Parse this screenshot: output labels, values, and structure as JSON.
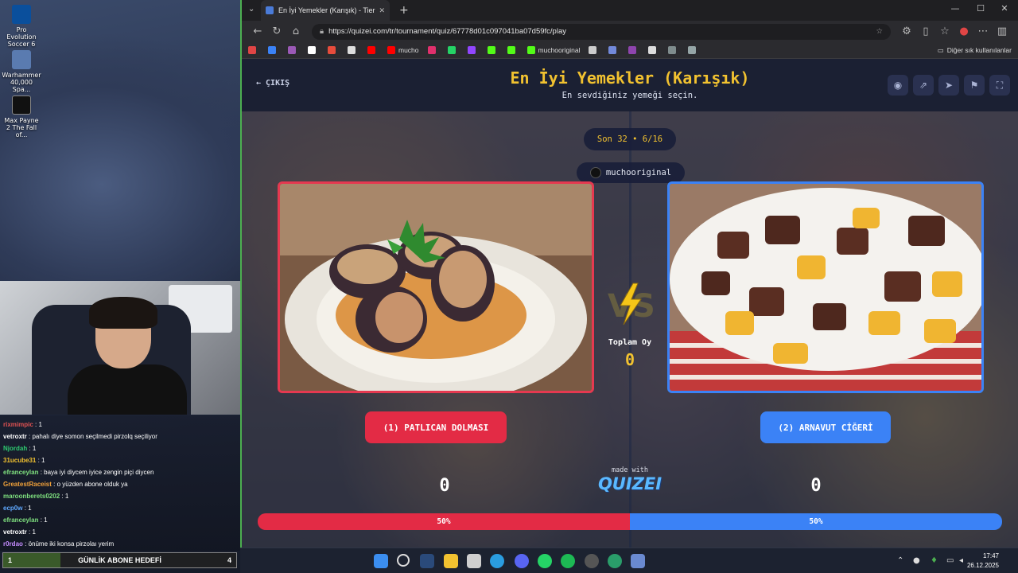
{
  "desktop": {
    "icons": [
      {
        "label": "Pro Evolution Soccer 6",
        "color": "#0a4f9c"
      },
      {
        "label": "Warhammer 40,000 Spa...",
        "color": "#5a7bb0"
      },
      {
        "label": "Max Payne 2 The Fall of...",
        "color": "#111111"
      }
    ]
  },
  "chat": {
    "lines": [
      {
        "user": "rixmimpic",
        "text": ": 1",
        "color": "#e05252"
      },
      {
        "user": "vetroxtr",
        "text": ": pahalı diye somon seçilmedi pirzolq seçiliyor",
        "color": "#ffffff"
      },
      {
        "user": "Njordah",
        "text": ": 1",
        "color": "#2ecc71"
      },
      {
        "user": "31ucube31",
        "text": ": 1",
        "color": "#f2c230"
      },
      {
        "user": "efranceylan",
        "text": ": baya iyi diycem iyice zengin piçi diycen",
        "color": "#7fe07f"
      },
      {
        "user": "GreatestRaceist",
        "text": ": o yüzden abone olduk ya",
        "color": "#f2a23a"
      },
      {
        "user": "maroonberets0202",
        "text": ": 1",
        "color": "#7fe07f"
      },
      {
        "user": "ecp0w",
        "text": ": 1",
        "color": "#5fa8ff"
      },
      {
        "user": "efranceylan",
        "text": ": 1",
        "color": "#7fe07f"
      },
      {
        "user": "vetroxtr",
        "text": ": 1",
        "color": "#ffffff"
      },
      {
        "user": "r0rdao",
        "text": ": önüme iki konsa pirzolaı yerim",
        "color": "#c58cff"
      }
    ],
    "goal": {
      "current": "1",
      "label": "GÜNLİK ABONE HEDEFİ",
      "target": "4"
    }
  },
  "browser": {
    "tab_title": "En İyi Yemekler (Karışık) - Tier List...",
    "url": "https://quizei.com/tr/tournament/quiz/67778d01c097041ba07d59fc/play",
    "bookmarks": [
      {
        "label": "",
        "color": "#e04545"
      },
      {
        "label": "",
        "color": "#3b82f6"
      },
      {
        "label": "",
        "color": "#9b59b6"
      },
      {
        "label": "",
        "color": "#ffffff"
      },
      {
        "label": "",
        "color": "#e74c3c"
      },
      {
        "label": "",
        "color": "#dddddd"
      },
      {
        "label": "",
        "color": "#ff0000"
      },
      {
        "label": "mucho",
        "color": "#ff0000"
      },
      {
        "label": "",
        "color": "#e1306c"
      },
      {
        "label": "",
        "color": "#25d366"
      },
      {
        "label": "",
        "color": "#9146ff"
      },
      {
        "label": "",
        "color": "#53fc18"
      },
      {
        "label": "",
        "color": "#53fc18"
      },
      {
        "label": "muchooriginal",
        "color": "#53fc18"
      },
      {
        "label": "",
        "color": "#cccccc"
      },
      {
        "label": "",
        "color": "#7289da"
      },
      {
        "label": "",
        "color": "#8e44ad"
      },
      {
        "label": "",
        "color": "#dddddd"
      },
      {
        "label": "",
        "color": "#7f8c8d"
      },
      {
        "label": "",
        "color": "#95a5a6"
      }
    ],
    "other_bookmarks": "Diğer sık kullanılanlar"
  },
  "quiz": {
    "exit_label": "ÇIKIŞ",
    "title": "En İyi Yemekler (Karışık)",
    "subtitle": "En sevdiğiniz yemeği seçin.",
    "round": "Son 32 • 6/16",
    "creator": "muchooriginal",
    "left": {
      "label": "(1) PATLICAN DOLMASI",
      "votes": "0",
      "percent": "50%",
      "color": "#e32b45"
    },
    "right": {
      "label": "(2) ARNAVUT CİĞERİ",
      "votes": "0",
      "percent": "50%",
      "color": "#3b82f6"
    },
    "vs": "VS",
    "total_label": "Toplam Oy",
    "total_value": "0",
    "made_with": "made with",
    "brand": "QUIZEI",
    "split_left": 0.5
  },
  "taskbar": {
    "time": "17:47",
    "date": "26.12.2025"
  }
}
